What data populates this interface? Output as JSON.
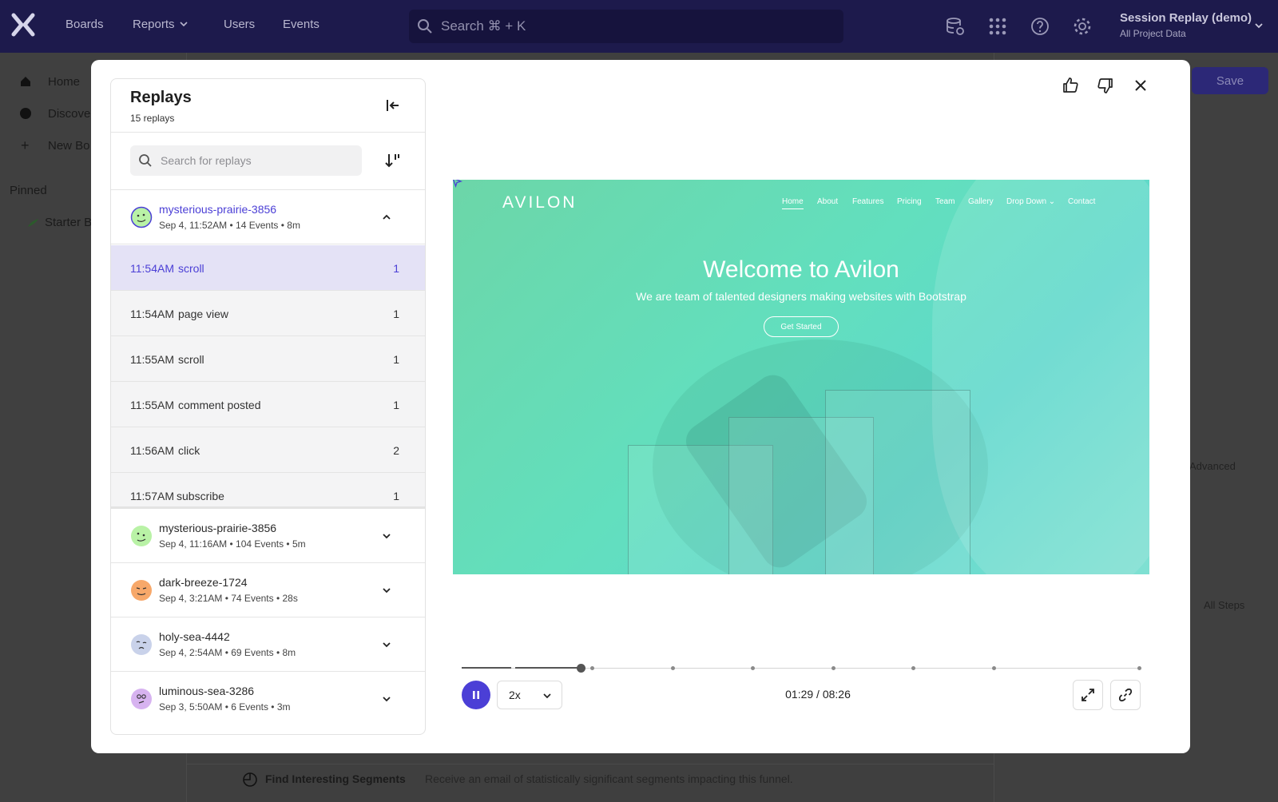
{
  "topnav": {
    "links": [
      "Boards",
      "Reports",
      "Users",
      "Events"
    ],
    "search_placeholder": "Search ⌘ + K",
    "project_name": "Session Replay (demo)",
    "project_scope": "All Project Data"
  },
  "background": {
    "sidebar": {
      "home": "Home",
      "discover": "Discove",
      "new_board": "New Bo",
      "pinned": "Pinned",
      "starter": "Starter B"
    },
    "save_label": "Save",
    "advanced_label": "Advanced",
    "all_steps_label": "All Steps",
    "bottom_title": "Find Interesting Segments",
    "bottom_desc": "Receive an email of statistically significant segments impacting this funnel."
  },
  "replays": {
    "title": "Replays",
    "count_label": "15 replays",
    "search_placeholder": "Search for replays",
    "active_session": {
      "name": "mysterious-prairie-3856",
      "meta": "Sep 4, 11:52AM • 14 Events • 8m"
    },
    "events": [
      {
        "time": "11:54AM",
        "name": "scroll",
        "count": "1"
      },
      {
        "time": "11:54AM",
        "name": "page view",
        "count": "1"
      },
      {
        "time": "11:55AM",
        "name": "scroll",
        "count": "1"
      },
      {
        "time": "11:55AM",
        "name": "comment posted",
        "count": "1"
      },
      {
        "time": "11:56AM",
        "name": "click",
        "count": "2"
      },
      {
        "time": "11:57AM",
        "name": "subscribe",
        "count": "1"
      }
    ],
    "sessions": [
      {
        "name": "mysterious-prairie-3856",
        "meta": "Sep 4, 11:16AM • 104 Events • 5m",
        "avatar_color": "#b9f2a6"
      },
      {
        "name": "dark-breeze-1724",
        "meta": "Sep 4, 3:21AM • 74 Events • 28s",
        "avatar_color": "#f7a86a"
      },
      {
        "name": "holy-sea-4442",
        "meta": "Sep 4, 2:54AM • 69 Events • 8m",
        "avatar_color": "#c9d2ea"
      },
      {
        "name": "luminous-sea-3286",
        "meta": "Sep 3, 5:50AM • 6 Events • 3m",
        "avatar_color": "#d7b3f0"
      }
    ]
  },
  "site": {
    "logo": "AVILON",
    "nav": [
      "Home",
      "About",
      "Features",
      "Pricing",
      "Team",
      "Gallery",
      "Drop Down ⌄",
      "Contact"
    ],
    "hero_title": "Welcome to Avilon",
    "hero_sub": "We are team of talented designers making websites with Bootstrap",
    "hero_button": "Get Started"
  },
  "player": {
    "speed": "2x",
    "timecode": "01:29 / 08:26",
    "progress": 0.176
  },
  "colors": {
    "accent": "#4b3fd6",
    "nav_bg": "#1d1a4c",
    "selected_row": "#e4e2f6"
  }
}
